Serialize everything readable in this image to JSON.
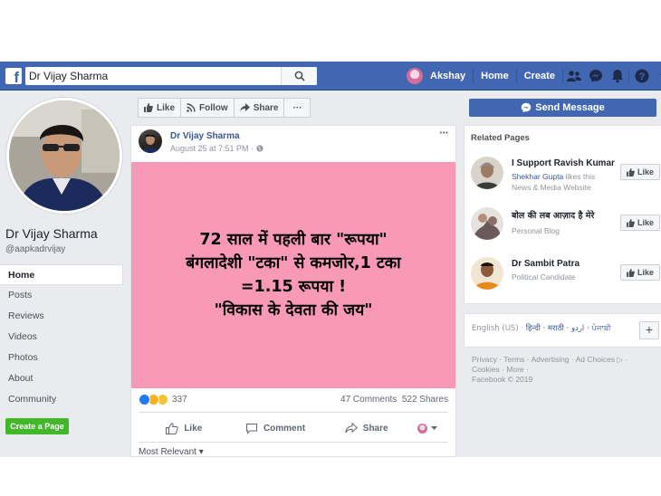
{
  "topbar": {
    "logo": "f",
    "search_value": "Dr Vijay Sharma",
    "user_name": "Akshay",
    "home_label": "Home",
    "create_label": "Create",
    "icons": [
      "friends-icon",
      "messenger-icon",
      "notifications-icon",
      "help-icon",
      "account-menu-icon"
    ]
  },
  "page": {
    "name": "Dr Vijay Sharma",
    "handle": "@aapkadrvijay",
    "nav": [
      "Home",
      "Posts",
      "Reviews",
      "Videos",
      "Photos",
      "About",
      "Community"
    ],
    "create_page_label": "Create a Page"
  },
  "action_bar": {
    "like": "Like",
    "follow": "Follow",
    "share": "Share",
    "more": "···"
  },
  "post": {
    "author": "Dr Vijay Sharma",
    "time": "August 25 at 7:51 PM ·",
    "more": "···",
    "image_text": [
      "72 साल में पहली बार \"रूपया\"",
      "बंगलादेशी \"टका\" से कमजोर,1 टका",
      "=1.15 रूपया !",
      "\"विकास के देवता की जय\""
    ],
    "reaction_count": "337",
    "comments": "47 Comments",
    "shares": "522 Shares",
    "like_label": "Like",
    "comment_label": "Comment",
    "share_label": "Share",
    "most_relevant": "Most Relevant ▾"
  },
  "sidebar": {
    "send_message": "Send Message",
    "related_title": "Related Pages",
    "related": [
      {
        "name": "I Support Ravish Kumar",
        "sub_link": "Shekhar Gupta",
        "sub_rest": " likes this",
        "sub2": "News & Media Website",
        "like": "Like"
      },
      {
        "name": "बोल की लब आज़ाद है मेरे",
        "sub_link": "",
        "sub_rest": "Personal Blog",
        "sub2": "",
        "like": "Like"
      },
      {
        "name": "Dr Sambit Patra",
        "sub_link": "",
        "sub_rest": "Political Candidate",
        "sub2": "",
        "like": "Like"
      }
    ],
    "languages": {
      "current": "English (US)",
      "others": "हिन्दी · मराठी · اردو · ਪੰਜਾਬੀ",
      "plus": "+"
    },
    "footer_line1": "Privacy · Terms · Advertising · Ad Choices ▷ ·",
    "footer_line2": "Cookies · More ·",
    "footer_line3": "Facebook © 2019"
  },
  "colors": {
    "brand": "#4267b2",
    "post_background": "#f999b8",
    "create_page": "#42b72a"
  }
}
